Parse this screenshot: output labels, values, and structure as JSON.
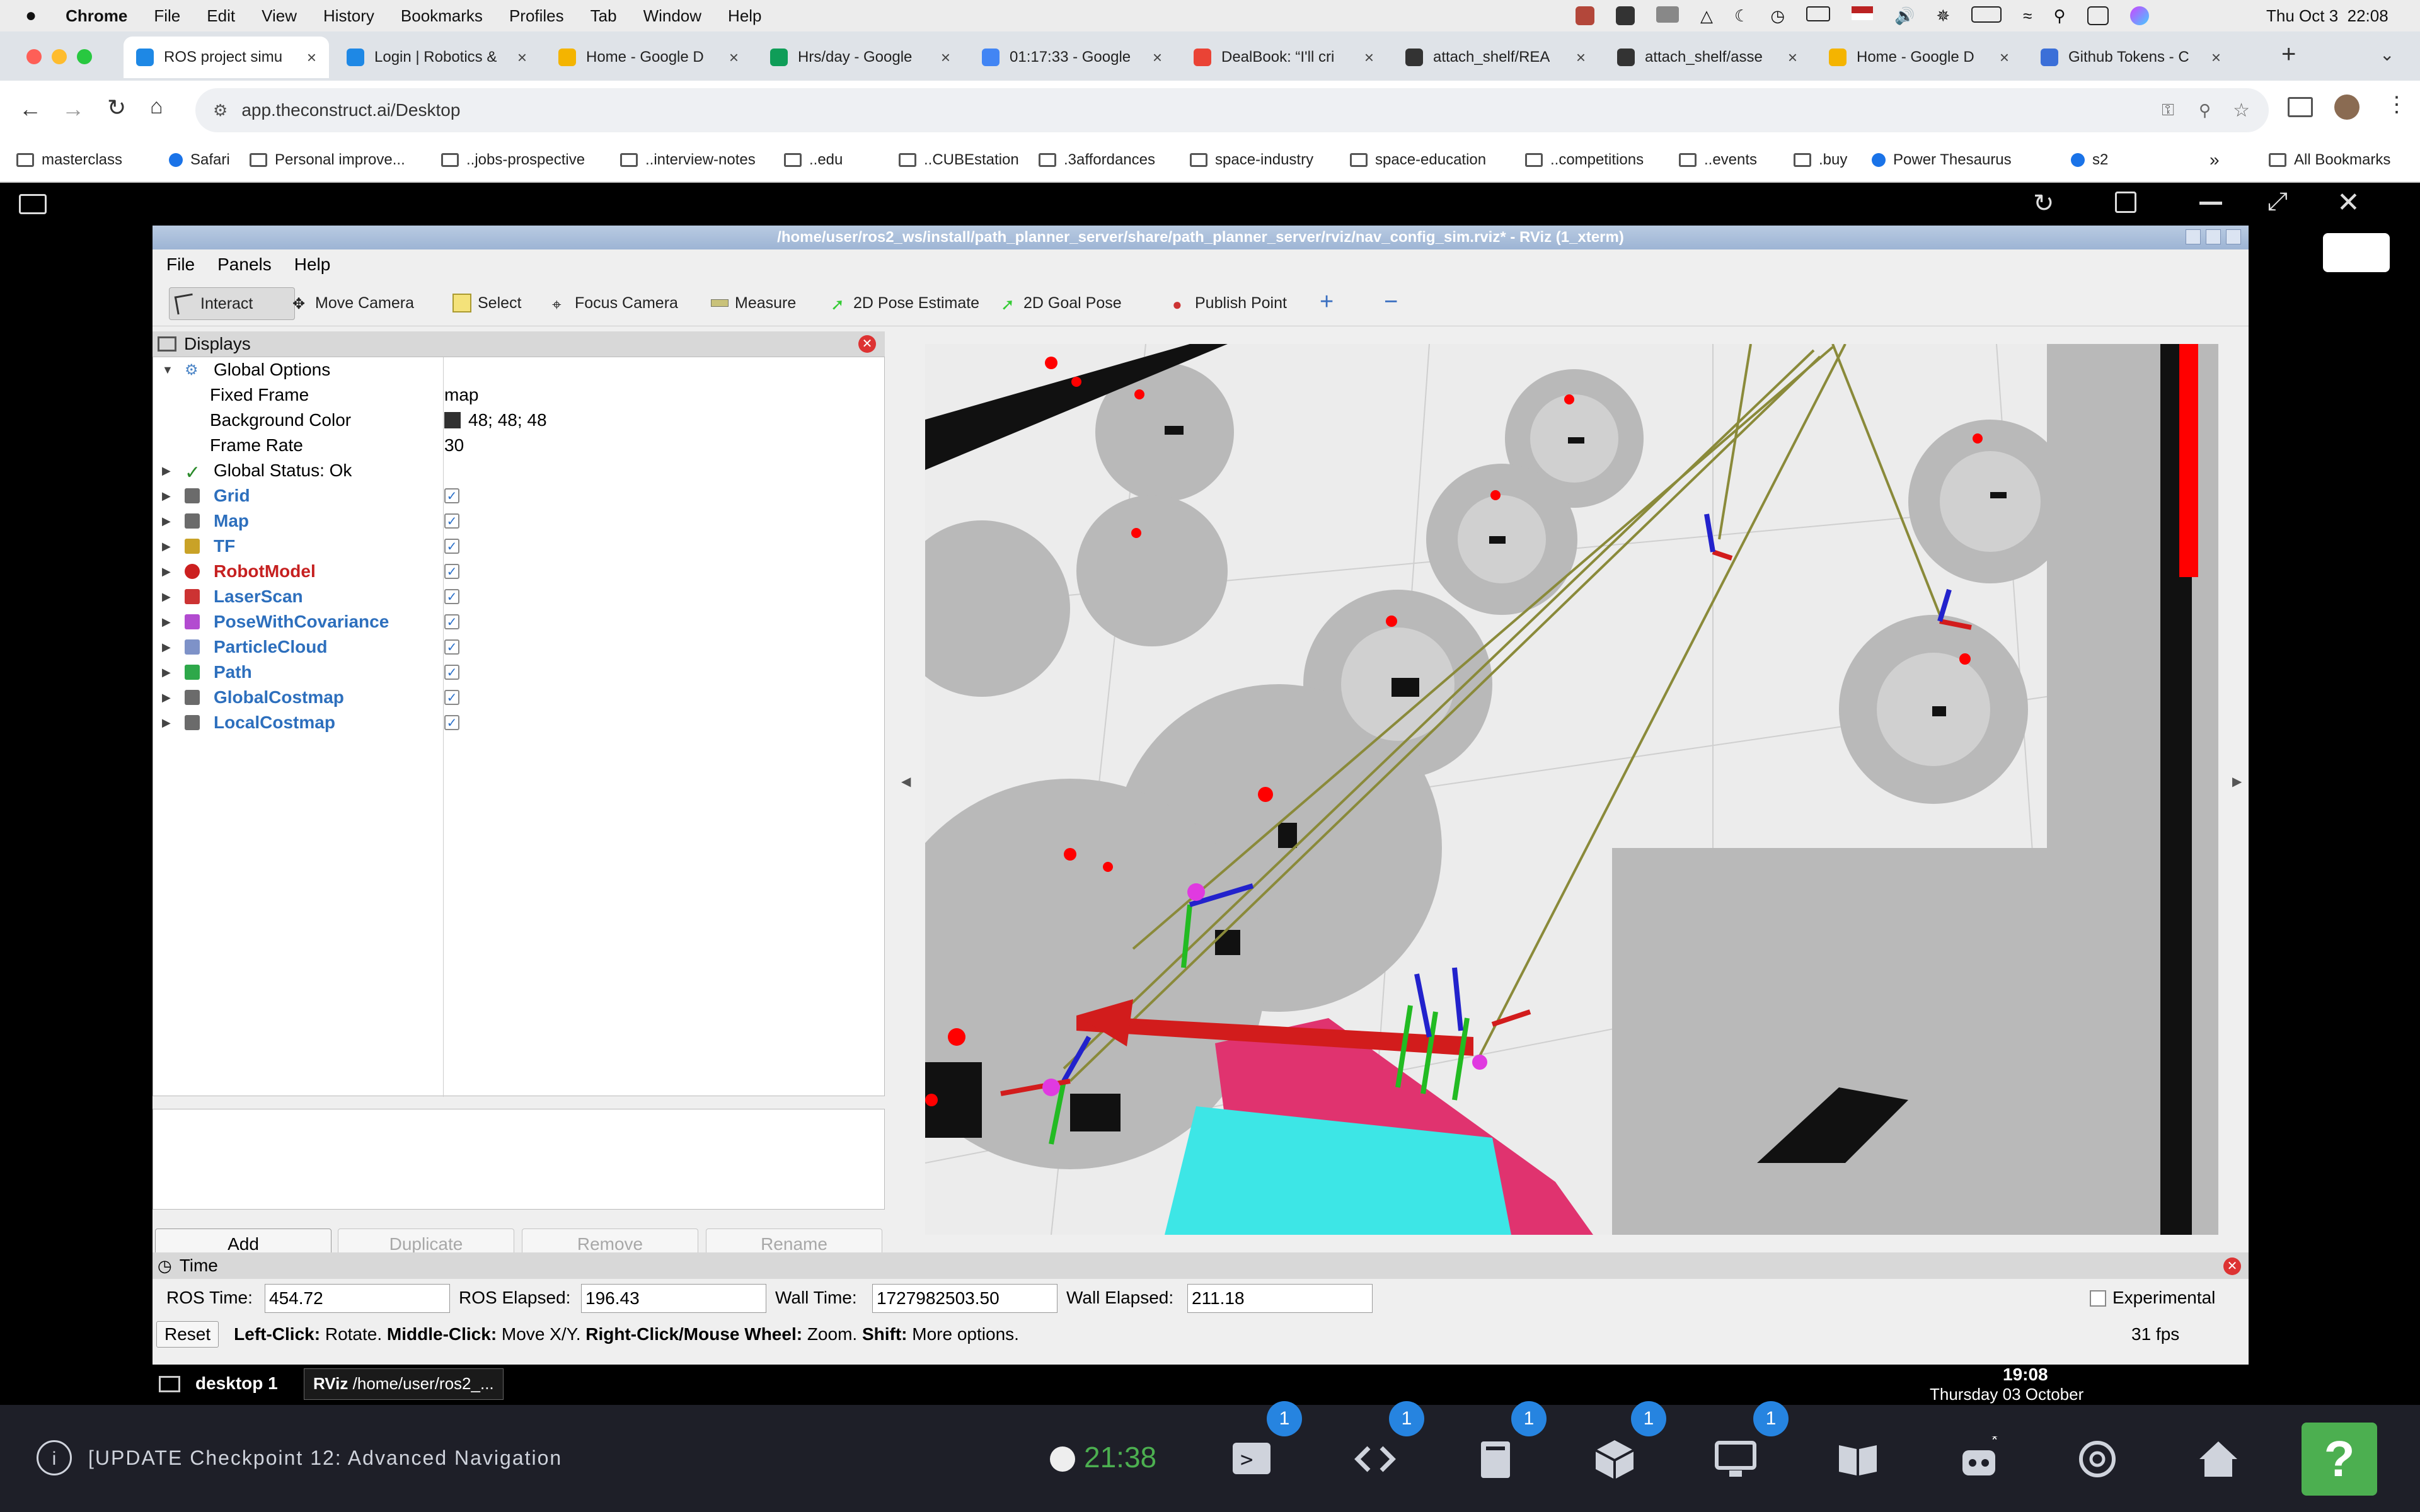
{
  "mac_menu": {
    "app": "Chrome",
    "items": [
      "File",
      "Edit",
      "View",
      "History",
      "Bookmarks",
      "Profiles",
      "Tab",
      "Window",
      "Help"
    ],
    "clock": "Thu Oct 3  22:08"
  },
  "tabs": [
    {
      "label": "ROS project simu",
      "color": "#1e88e5"
    },
    {
      "label": "Login | Robotics &",
      "color": "#1e88e5"
    },
    {
      "label": "Home - Google D",
      "color": "#f4b400"
    },
    {
      "label": "Hrs/day - Google",
      "color": "#0f9d58"
    },
    {
      "label": "01:17:33 - Google",
      "color": "#4285f4"
    },
    {
      "label": "DealBook: “I'll cri",
      "color": "#ea4335"
    },
    {
      "label": "attach_shelf/REA",
      "color": "#333333"
    },
    {
      "label": "attach_shelf/asse",
      "color": "#333333"
    },
    {
      "label": "Home - Google D",
      "color": "#f4b400"
    },
    {
      "label": "Github Tokens - C",
      "color": "#3b6fd8"
    }
  ],
  "address": {
    "url": "app.theconstruct.ai/Desktop"
  },
  "bookmarks": [
    {
      "label": "masterclass",
      "folder": true
    },
    {
      "label": "Safari",
      "folder": false
    },
    {
      "label": "Personal improve...",
      "folder": true
    },
    {
      "label": "..jobs-prospective",
      "folder": true
    },
    {
      "label": "..interview-notes",
      "folder": true
    },
    {
      "label": "..edu",
      "folder": true
    },
    {
      "label": "..CUBEstation",
      "folder": true
    },
    {
      "label": ".3affordances",
      "folder": true
    },
    {
      "label": "space-industry",
      "folder": true
    },
    {
      "label": "space-education",
      "folder": true
    },
    {
      "label": "..competitions",
      "folder": true
    },
    {
      "label": "..events",
      "folder": true
    },
    {
      "label": ".buy",
      "folder": true
    },
    {
      "label": "Power Thesaurus",
      "folder": false
    },
    {
      "label": "s2",
      "folder": false
    }
  ],
  "all_bookmarks": "All Bookmarks",
  "rviz": {
    "title": "/home/user/ros2_ws/install/path_planner_server/share/path_planner_server/rviz/nav_config_sim.rviz* - RViz (1_xterm)",
    "menu": [
      "File",
      "Panels",
      "Help"
    ],
    "tools": [
      "Interact",
      "Move Camera",
      "Select",
      "Focus Camera",
      "Measure",
      "2D Pose Estimate",
      "2D Goal Pose",
      "Publish Point"
    ],
    "displays_title": "Displays",
    "global_options": {
      "label": "Global Options",
      "props": [
        {
          "name": "Fixed Frame",
          "value": "map"
        },
        {
          "name": "Background Color",
          "value": "48; 48; 48"
        },
        {
          "name": "Frame Rate",
          "value": "30"
        }
      ],
      "status": "Global Status: Ok"
    },
    "displays": [
      {
        "label": "Grid",
        "error": false
      },
      {
        "label": "Map",
        "error": false
      },
      {
        "label": "TF",
        "error": false
      },
      {
        "label": "RobotModel",
        "error": true
      },
      {
        "label": "LaserScan",
        "error": false
      },
      {
        "label": "PoseWithCovariance",
        "error": false
      },
      {
        "label": "ParticleCloud",
        "error": false
      },
      {
        "label": "Path",
        "error": false
      },
      {
        "label": "GlobalCostmap",
        "error": false
      },
      {
        "label": "LocalCostmap",
        "error": false
      }
    ],
    "buttons": {
      "add": "Add",
      "duplicate": "Duplicate",
      "remove": "Remove",
      "rename": "Rename"
    },
    "time": {
      "title": "Time",
      "ros_time_label": "ROS Time:",
      "ros_time": "454.72",
      "ros_elapsed_label": "ROS Elapsed:",
      "ros_elapsed": "196.43",
      "wall_time_label": "Wall Time:",
      "wall_time": "1727982503.50",
      "wall_elapsed_label": "Wall Elapsed:",
      "wall_elapsed": "211.18",
      "experimental": "Experimental"
    },
    "status": {
      "reset": "Reset",
      "k1": "Left-Click:",
      "v1": " Rotate. ",
      "k2": "Middle-Click:",
      "v2": " Move X/Y. ",
      "k3": "Right-Click/Mouse Wheel:",
      "v3": " Zoom. ",
      "k4": "Shift:",
      "v4": " More options.",
      "fps": "31 fps"
    }
  },
  "desktop": {
    "workspace": "desktop 1",
    "task": "/home/user/ros2_...",
    "time": "19:08",
    "date": "Thursday 03 October"
  },
  "dock": {
    "checkpoint": "[UPDATE Checkpoint 12: Advanced Navigation",
    "timer": "21:38",
    "badges": [
      "1",
      "1",
      "1",
      "1",
      "1"
    ],
    "help": "?"
  },
  "colors": {
    "accent_green": "#4caf50",
    "badge_blue": "#2684e0",
    "rviz_title": "#9db4d4",
    "error_red": "#c62020",
    "display_blue": "#2d6fbd"
  }
}
